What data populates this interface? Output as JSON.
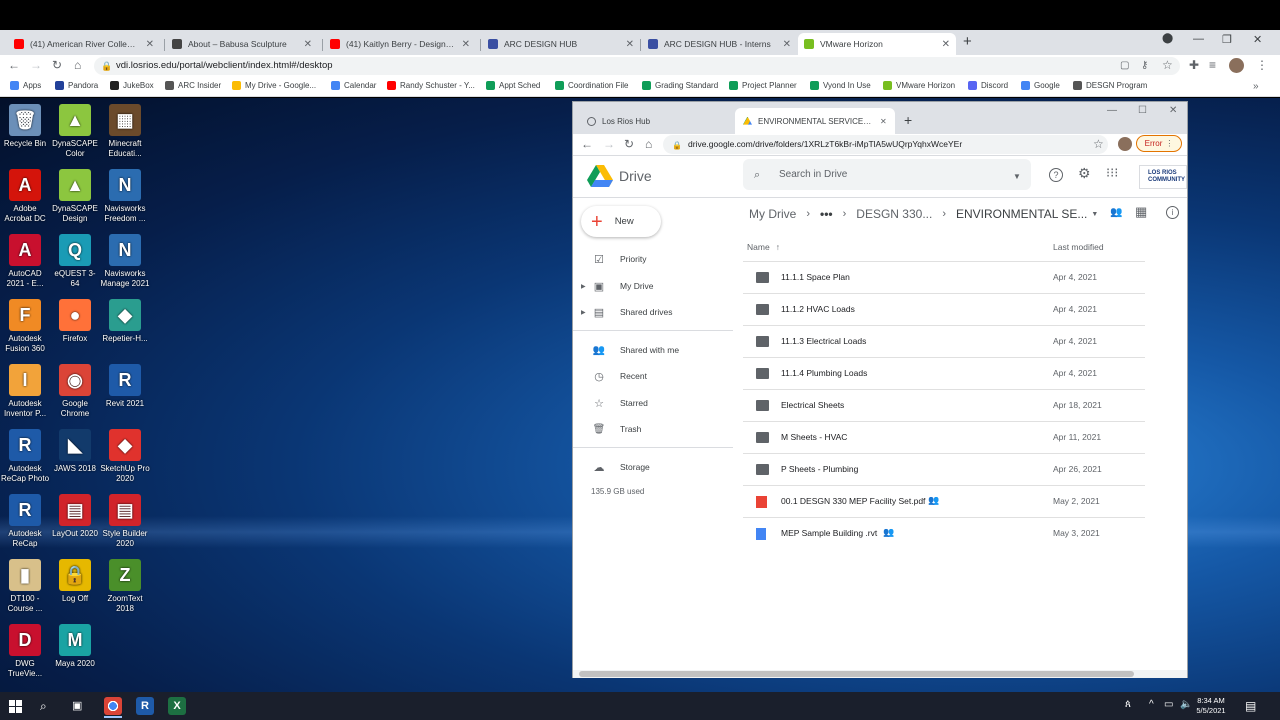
{
  "outer_tabs": [
    {
      "label": "(41) American River College Tech",
      "icon_color": "#ff0000"
    },
    {
      "label": "About – Babusa Sculpture",
      "icon_color": "#444444"
    },
    {
      "label": "(41) Kaitlyn Berry - Design Hub In",
      "icon_color": "#ff0000"
    },
    {
      "label": "ARC DESIGN HUB",
      "icon_color": "#3a4fa2"
    },
    {
      "label": "ARC DESIGN HUB - Interns",
      "icon_color": "#3a4fa2"
    },
    {
      "label": "VMware Horizon",
      "icon_color": "#78be20"
    }
  ],
  "outer_url": "vdi.losrios.edu/portal/webclient/index.html#/desktop",
  "bookmarks": [
    {
      "label": "Apps",
      "color": "#4285f4"
    },
    {
      "label": "Pandora",
      "color": "#224099"
    },
    {
      "label": "JukeBox",
      "color": "#222222"
    },
    {
      "label": "ARC Insider",
      "color": "#555555"
    },
    {
      "label": "My Drive - Google...",
      "color": "#fbbc04"
    },
    {
      "label": "Calendar",
      "color": "#4285f4"
    },
    {
      "label": "Randy Schuster - Y...",
      "color": "#ff0000"
    },
    {
      "label": "Appt Sched",
      "color": "#0f9d58"
    },
    {
      "label": "Coordination File",
      "color": "#0f9d58"
    },
    {
      "label": "Grading Standard",
      "color": "#0f9d58"
    },
    {
      "label": "Project Planner",
      "color": "#0f9d58"
    },
    {
      "label": "Vyond In Use",
      "color": "#0f9d58"
    },
    {
      "label": "VMware Horizon",
      "color": "#78be20"
    },
    {
      "label": "Discord",
      "color": "#5865f2"
    },
    {
      "label": "Google",
      "color": "#4285f4"
    },
    {
      "label": "DESGN Program",
      "color": "#555555"
    }
  ],
  "desktop_icons": [
    {
      "label": "Recycle Bin",
      "glyph": "🗑",
      "color": "#6b8fb8"
    },
    {
      "label": "DynaSCAPE Color",
      "glyph": "▲",
      "color": "#8cc63f"
    },
    {
      "label": "Minecraft Educati...",
      "glyph": "▦",
      "color": "#6b4a2b"
    },
    {
      "label": "Adobe Acrobat DC",
      "glyph": "A",
      "color": "#d4140b"
    },
    {
      "label": "DynaSCAPE Design",
      "glyph": "▲",
      "color": "#8cc63f"
    },
    {
      "label": "Navisworks Freedom ...",
      "glyph": "N",
      "color": "#2b6cb0"
    },
    {
      "label": "AutoCAD 2021 - E...",
      "glyph": "A",
      "color": "#c8102e"
    },
    {
      "label": "eQUEST 3-64",
      "glyph": "Q",
      "color": "#1a9bb5"
    },
    {
      "label": "Navisworks Manage 2021",
      "glyph": "N",
      "color": "#2b6cb0"
    },
    {
      "label": "Autodesk Fusion 360",
      "glyph": "F",
      "color": "#f08a24"
    },
    {
      "label": "Firefox",
      "glyph": "●",
      "color": "#ff7139"
    },
    {
      "label": "Repetier-H...",
      "glyph": "◆",
      "color": "#2a9d8f"
    },
    {
      "label": "Autodesk Inventor P...",
      "glyph": "I",
      "color": "#f2a33a"
    },
    {
      "label": "Google Chrome",
      "glyph": "◉",
      "color": "#db4437"
    },
    {
      "label": "Revit 2021",
      "glyph": "R",
      "color": "#1e5aa8"
    },
    {
      "label": "Autodesk ReCap Photo",
      "glyph": "R",
      "color": "#1e5aa8"
    },
    {
      "label": "JAWS 2018",
      "glyph": "◣",
      "color": "#123a6b"
    },
    {
      "label": "SketchUp Pro 2020",
      "glyph": "◆",
      "color": "#e0322d"
    },
    {
      "label": "Autodesk ReCap",
      "glyph": "R",
      "color": "#1e5aa8"
    },
    {
      "label": "LayOut 2020",
      "glyph": "▤",
      "color": "#d1242a"
    },
    {
      "label": "Style Builder 2020",
      "glyph": "▤",
      "color": "#d1242a"
    },
    {
      "label": "DT100 - Course ...",
      "glyph": "▮",
      "color": "#d8c08a"
    },
    {
      "label": "Log Off",
      "glyph": "🔒",
      "color": "#e6b800"
    },
    {
      "label": "ZoomText 2018",
      "glyph": "Z",
      "color": "#4a8f2a"
    },
    {
      "label": "DWG TrueVie...",
      "glyph": "D",
      "color": "#c8102e"
    },
    {
      "label": "Maya 2020",
      "glyph": "M",
      "color": "#1aa3a3"
    }
  ],
  "inner_tabs": [
    {
      "label": "Los Rios Hub"
    },
    {
      "label": "ENVIRONMENTAL SERVICES CO..."
    }
  ],
  "inner_url": "drive.google.com/drive/folders/1XRLzT6kBr-iMpTlA5wUQrpYqhxWceYEr",
  "error_label": "Error",
  "drive": {
    "brand": "Drive",
    "search_placeholder": "Search in Drive",
    "org_logo": "LOS RIOS COMMUNITY",
    "new_label": "New",
    "nav": [
      {
        "label": "Priority",
        "icon": "☑"
      },
      {
        "label": "My Drive",
        "icon": "▣"
      },
      {
        "label": "Shared drives",
        "icon": "▤"
      },
      {
        "label": "Shared with me",
        "icon": "👥"
      },
      {
        "label": "Recent",
        "icon": "◷"
      },
      {
        "label": "Starred",
        "icon": "☆"
      },
      {
        "label": "Trash",
        "icon": "🗑"
      }
    ],
    "storage_label": "Storage",
    "storage_used": "135.9 GB used",
    "breadcrumb": [
      "My Drive",
      "DESGN 330...",
      "ENVIRONMENTAL SE..."
    ],
    "columns": {
      "name": "Name",
      "modified": "Last modified"
    },
    "files": [
      {
        "name": "11.1.1 Space Plan",
        "date": "Apr 4, 2021",
        "type": "folder"
      },
      {
        "name": "11.1.2 HVAC Loads",
        "date": "Apr 4, 2021",
        "type": "folder"
      },
      {
        "name": "11.1.3 Electrical Loads",
        "date": "Apr 4, 2021",
        "type": "folder"
      },
      {
        "name": "11.1.4 Plumbing Loads",
        "date": "Apr 4, 2021",
        "type": "folder"
      },
      {
        "name": "Electrical Sheets",
        "date": "Apr 18, 2021",
        "type": "folder"
      },
      {
        "name": "M Sheets - HVAC",
        "date": "Apr 11, 2021",
        "type": "folder"
      },
      {
        "name": "P Sheets - Plumbing",
        "date": "Apr 26, 2021",
        "type": "folder"
      },
      {
        "name": "00.1 DESGN 330 MEP Facility Set.pdf",
        "date": "May 2, 2021",
        "type": "pdf"
      },
      {
        "name": "MEP Sample Building .rvt",
        "date": "May 3, 2021",
        "type": "doc"
      }
    ]
  },
  "taskbar": {
    "time": "8:34 AM",
    "date": "5/5/2021"
  }
}
